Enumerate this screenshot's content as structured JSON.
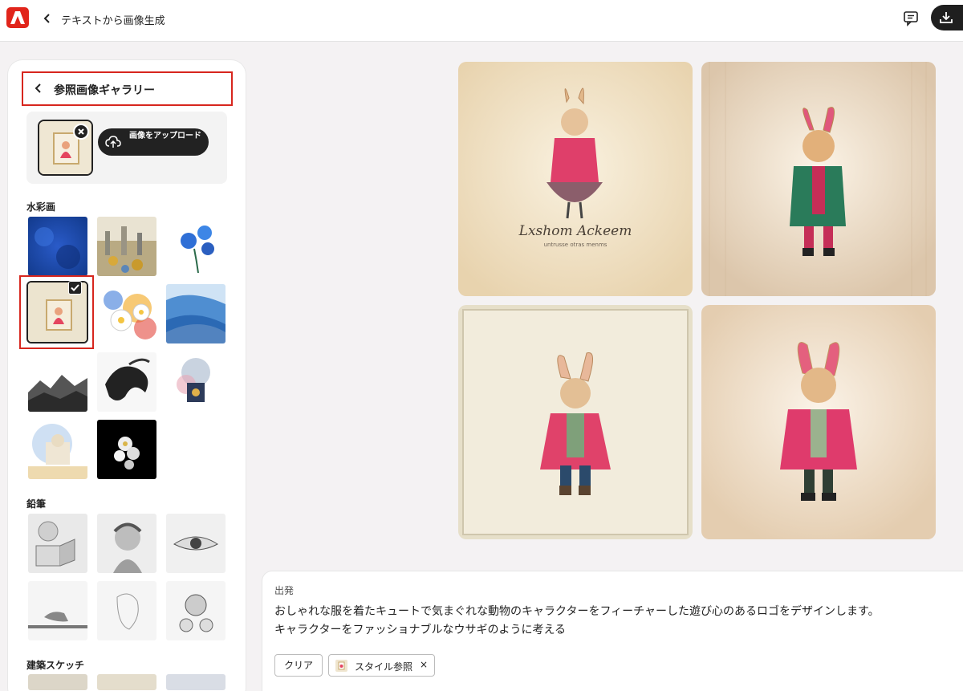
{
  "app": {
    "title": "テキストから画像生成"
  },
  "gallery": {
    "title": "参照画像ギャラリー",
    "upload_label": "画像をアップロード",
    "sections": [
      "水彩画",
      "鉛筆",
      "建築スケッチ"
    ]
  },
  "prompt": {
    "label": "出発",
    "line1": "おしゃれな服を着たキュートで気まぐれな動物のキャラクターをフィーチャーした遊び心のあるロゴをデザインします。",
    "line2": "キャラクターをファッショナブルなウサギのように考える",
    "clear_label": "クリア",
    "style_chip_label": "スタイル参照",
    "style_chip_close": "×"
  },
  "results": {
    "logo_script": "Lxshom Ackeem",
    "logo_subtitle": "untrusse otras menms"
  },
  "colors": {
    "accent": "#d7261e",
    "brand": "#e1251b",
    "dark": "#1f1f1f"
  }
}
